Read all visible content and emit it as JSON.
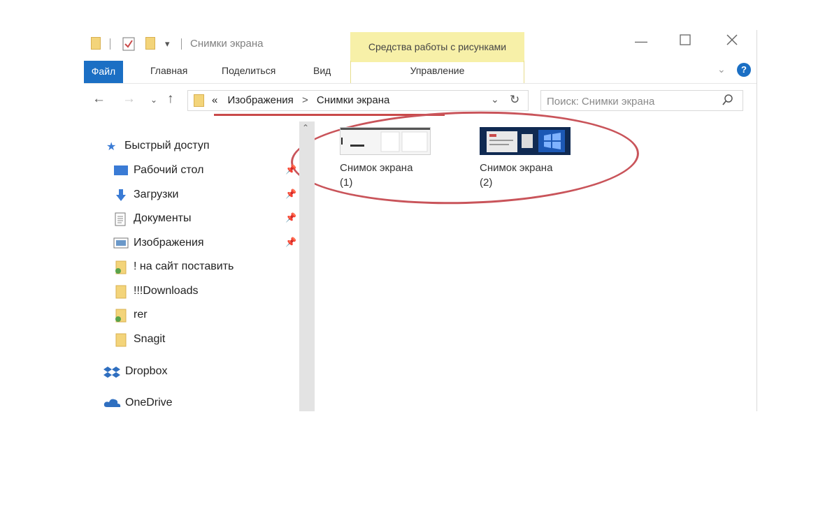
{
  "window": {
    "title": "Снимки экрана",
    "contextual_tab": "Средства работы с рисунками"
  },
  "ribbon": {
    "tabs": [
      "Файл",
      "Главная",
      "Поделиться",
      "Вид"
    ],
    "contextual_subtab": "Управление"
  },
  "address": {
    "prefix": "«",
    "crumbs": [
      "Изображения",
      "Снимки экрана"
    ],
    "separator": ">"
  },
  "search": {
    "placeholder": "Поиск: Снимки экрана"
  },
  "sidebar": {
    "quick_access": "Быстрый доступ",
    "items": [
      {
        "label": "Рабочий стол",
        "icon": "desktop-icon",
        "pinned": true
      },
      {
        "label": "Загрузки",
        "icon": "download-arrow-icon",
        "pinned": true
      },
      {
        "label": "Документы",
        "icon": "document-icon",
        "pinned": true
      },
      {
        "label": "Изображения",
        "icon": "pictures-icon",
        "pinned": true
      },
      {
        "label": "! на сайт поставить",
        "icon": "shared-folder-icon",
        "pinned": false
      },
      {
        "label": "!!!Downloads",
        "icon": "folder-icon",
        "pinned": false
      },
      {
        "label": "rer",
        "icon": "shared-folder-icon",
        "pinned": false
      },
      {
        "label": "Snagit",
        "icon": "folder-icon",
        "pinned": false
      }
    ],
    "dropbox": "Dropbox",
    "onedrive": "OneDrive"
  },
  "files": [
    {
      "name": "Снимок экрана",
      "index": "(1)"
    },
    {
      "name": "Снимок экрана",
      "index": "(2)"
    }
  ],
  "colors": {
    "accent": "#1b6fc4",
    "contextual": "#f7f0a8",
    "annotation": "#c94a4a",
    "folder": "#f3d47a"
  }
}
